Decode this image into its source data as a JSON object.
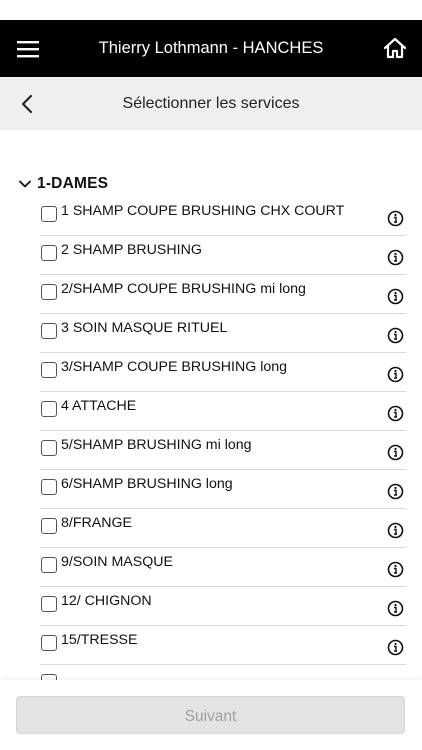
{
  "header": {
    "title": "Thierry Lothmann - HANCHES",
    "menu_icon": "hamburger-menu-icon",
    "home_icon": "home-icon",
    "background": "#000000"
  },
  "subheader": {
    "title": "Sélectionner les services",
    "back_icon": "chevron-left-icon",
    "background": "#efefef"
  },
  "group": {
    "label": "1-DAMES",
    "expanded": true,
    "items": [
      {
        "label": "1 SHAMP COUPE BRUSHING CHX COURT",
        "checked": false
      },
      {
        "label": "2 SHAMP BRUSHING",
        "checked": false
      },
      {
        "label": "2/SHAMP COUPE BRUSHING mi long",
        "checked": false
      },
      {
        "label": "3 SOIN MASQUE RITUEL",
        "checked": false
      },
      {
        "label": "3/SHAMP COUPE BRUSHING long",
        "checked": false
      },
      {
        "label": "4 ATTACHE",
        "checked": false
      },
      {
        "label": "5/SHAMP BRUSHING mi long",
        "checked": false
      },
      {
        "label": "6/SHAMP BRUSHING long",
        "checked": false
      },
      {
        "label": "8/FRANGE",
        "checked": false
      },
      {
        "label": "9/SOIN MASQUE",
        "checked": false
      },
      {
        "label": "12/ CHIGNON",
        "checked": false
      },
      {
        "label": "15/TRESSE",
        "checked": false
      }
    ]
  },
  "footer": {
    "next_label": "Suivant",
    "next_disabled": true
  }
}
